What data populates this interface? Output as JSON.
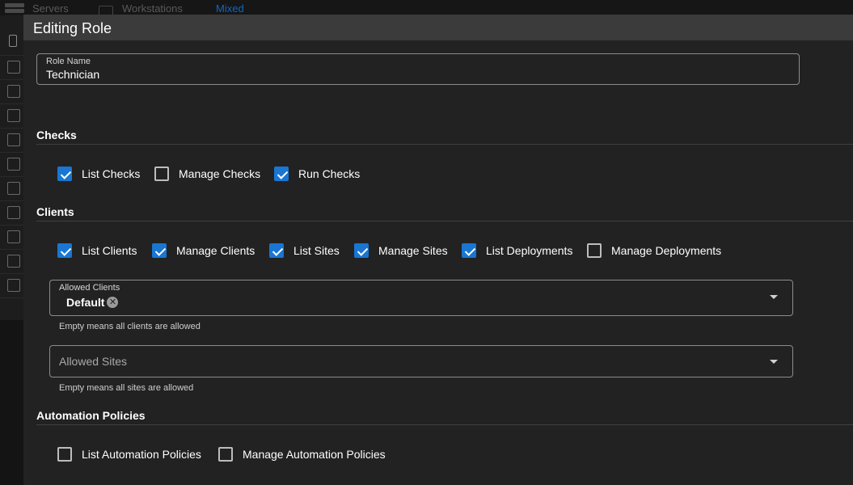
{
  "background": {
    "tabs": [
      "Servers",
      "Workstations",
      "Mixed"
    ],
    "rows": 10
  },
  "dialog": {
    "title": "Editing Role",
    "role_name": {
      "label": "Role Name",
      "value": "Technician"
    },
    "sections": {
      "checks": {
        "title": "Checks",
        "options": [
          {
            "label": "List Checks",
            "checked": true
          },
          {
            "label": "Manage Checks",
            "checked": false
          },
          {
            "label": "Run Checks",
            "checked": true
          }
        ]
      },
      "clients": {
        "title": "Clients",
        "options": [
          {
            "label": "List Clients",
            "checked": true
          },
          {
            "label": "Manage Clients",
            "checked": true
          },
          {
            "label": "List Sites",
            "checked": true
          },
          {
            "label": "Manage Sites",
            "checked": true
          },
          {
            "label": "List Deployments",
            "checked": true
          },
          {
            "label": "Manage Deployments",
            "checked": false
          }
        ],
        "allowed_clients": {
          "label": "Allowed Clients",
          "chips": [
            "Default"
          ],
          "hint": "Empty means all clients are allowed"
        },
        "allowed_sites": {
          "placeholder": "Allowed Sites",
          "hint": "Empty means all sites are allowed"
        }
      },
      "automation": {
        "title": "Automation Policies",
        "options": [
          {
            "label": "List Automation Policies",
            "checked": false
          },
          {
            "label": "Manage Automation Policies",
            "checked": false
          }
        ]
      }
    }
  },
  "colors": {
    "accent": "#1976d2",
    "dialog_bg": "#222222",
    "header_bg": "#3b3b3b"
  }
}
